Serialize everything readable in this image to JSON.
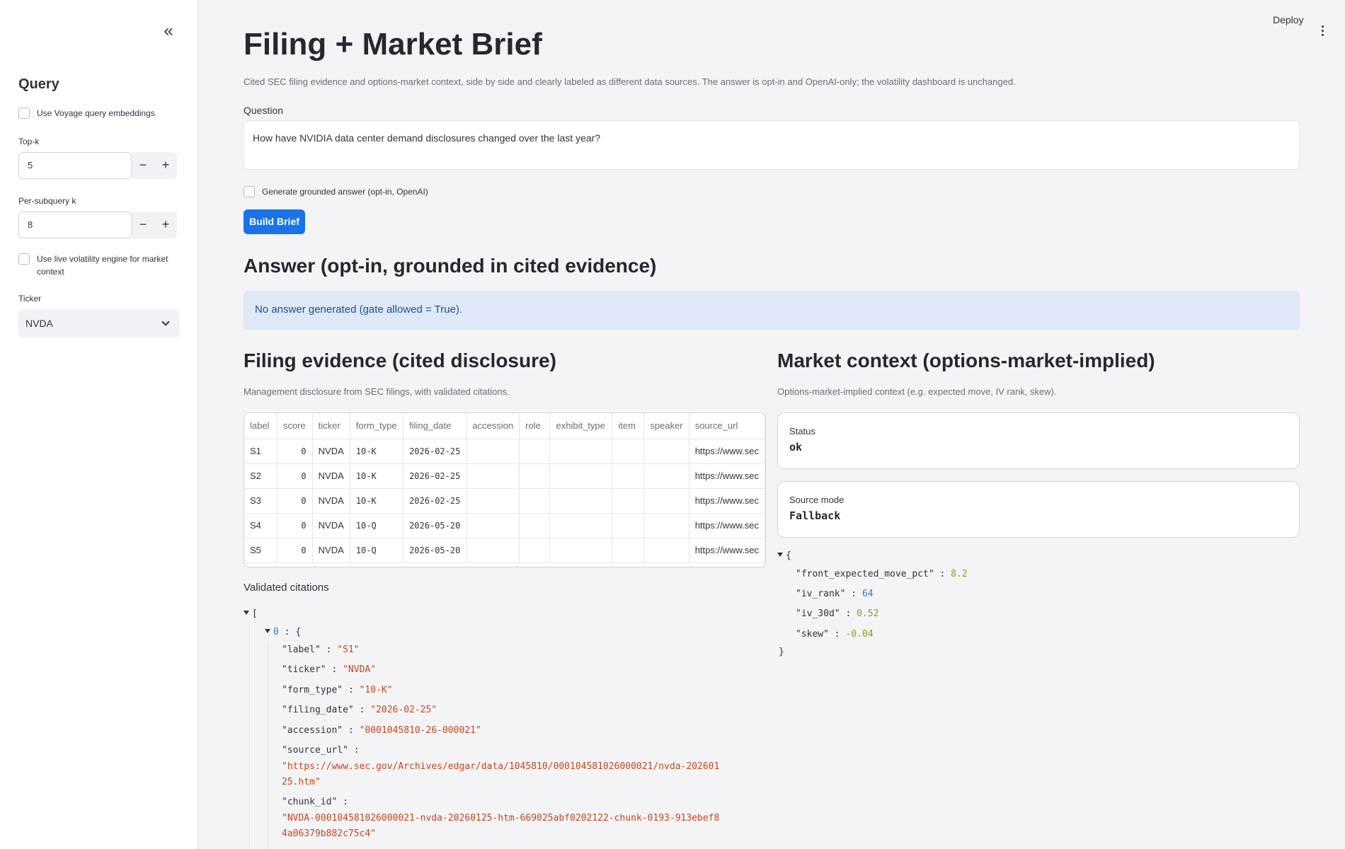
{
  "sidebar": {
    "collapse_icon": "chevrons-left-icon",
    "title": "Query",
    "voyage_label": "Use Voyage query embeddings",
    "topk_label": "Top-k",
    "topk_value": "5",
    "persub_label": "Per-subquery k",
    "persub_value": "8",
    "minus": "−",
    "plus": "+",
    "live_vol_label": "Use live volatility engine for market context",
    "ticker_label": "Ticker",
    "ticker_value": "NVDA"
  },
  "header": {
    "deploy_label": "Deploy",
    "menu_icon": "kebab-menu-icon"
  },
  "main": {
    "title": "Filing + Market Brief",
    "intro": "Cited SEC filing evidence and options-market context, side by side and clearly labeled as different data sources. The answer is opt-in and OpenAI-only; the volatility dashboard is unchanged.",
    "question_label": "Question",
    "question_value": "How have NVIDIA data center demand disclosures changed over the last year?",
    "generate_label": "Generate grounded answer (opt-in, OpenAI)",
    "build_label": "Build Brief",
    "answer_heading": "Answer (opt-in, grounded in cited evidence)",
    "answer_info": "No answer generated (gate allowed = True).",
    "filing_heading": "Filing evidence (cited disclosure)",
    "filing_caption": "Management disclosure from SEC filings, with validated citations.",
    "market_heading": "Market context (options-market-implied)",
    "market_caption": "Options-market-implied context (e.g. expected move, IV rank, skew).",
    "citations_label": "Validated citations"
  },
  "table": {
    "columns": [
      "label",
      "score",
      "ticker",
      "form_type",
      "filing_date",
      "accession",
      "role",
      "exhibit_type",
      "item",
      "speaker",
      "source_url"
    ],
    "rows": [
      [
        "S1",
        "0",
        "NVDA",
        "10-K",
        "2026-02-25",
        "",
        "",
        "",
        "",
        "",
        "https://www.sec"
      ],
      [
        "S2",
        "0",
        "NVDA",
        "10-K",
        "2026-02-25",
        "",
        "",
        "",
        "",
        "",
        "https://www.sec"
      ],
      [
        "S3",
        "0",
        "NVDA",
        "10-K",
        "2026-02-25",
        "",
        "",
        "",
        "",
        "",
        "https://www.sec"
      ],
      [
        "S4",
        "0",
        "NVDA",
        "10-Q",
        "2026-05-20",
        "",
        "",
        "",
        "",
        "",
        "https://www.sec"
      ],
      [
        "S5",
        "0",
        "NVDA",
        "10-Q",
        "2026-05-20",
        "",
        "",
        "",
        "",
        "",
        "https://www.sec"
      ]
    ]
  },
  "market": {
    "status_label": "Status",
    "status_value": "ok",
    "source_label": "Source mode",
    "source_value": "Fallback",
    "json": {
      "open": "{",
      "close": "}",
      "k1": "\"front_expected_move_pct\"",
      "v1": "8.2",
      "k2": "\"iv_rank\"",
      "v2": "64",
      "k3": "\"iv_30d\"",
      "v3": "0.52",
      "k4": "\"skew\"",
      "v4": "-0.04"
    }
  },
  "citations": {
    "open": "[",
    "idx": "0",
    "obj_open": "{",
    "label_k": "\"label\"",
    "label_v": "\"S1\"",
    "ticker_k": "\"ticker\"",
    "ticker_v": "\"NVDA\"",
    "form_k": "\"form_type\"",
    "form_v": "\"10-K\"",
    "date_k": "\"filing_date\"",
    "date_v": "\"2026-02-25\"",
    "acc_k": "\"accession\"",
    "acc_v": "\"0001045810-26-000021\"",
    "url_k": "\"source_url\"",
    "url_v1": "\"https://www.sec.gov/Archives/edgar/data/1045810/000104581026000021/nvda-202601",
    "url_v2": "25.htm\"",
    "chunk_k": "\"chunk_id\"",
    "chunk_v1": "\"NVDA-000104581026000021-nvda-20260125-htm-669025abf0202122-chunk-0193-913ebef8",
    "chunk_v2": "4a06379b882c75c4\""
  }
}
